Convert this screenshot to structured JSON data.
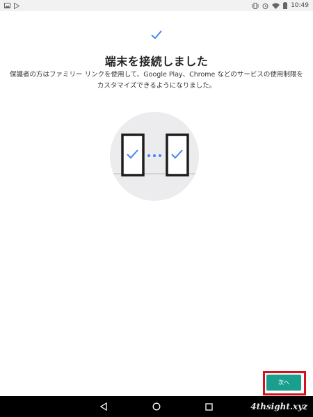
{
  "status_bar": {
    "time": "10:49"
  },
  "main": {
    "title": "端末を接続しました",
    "description": "保護者の方はファミリー リンクを使用して、Google Play、Chrome などのサービスの使用制限をカスタマイズできるようになりました。"
  },
  "actions": {
    "next_label": "次へ"
  },
  "watermark": {
    "text": "4thsight.xyz"
  },
  "colors": {
    "accent": "#4285f4",
    "button": "#1a9f8e",
    "highlight": "#d8101e"
  },
  "icons": {
    "status_left": [
      "image-icon",
      "play-store-icon"
    ],
    "status_right": [
      "vibrate-icon",
      "alarm-icon",
      "wifi-icon",
      "battery-icon"
    ],
    "nav": [
      "back-icon",
      "home-icon",
      "recents-icon"
    ]
  }
}
